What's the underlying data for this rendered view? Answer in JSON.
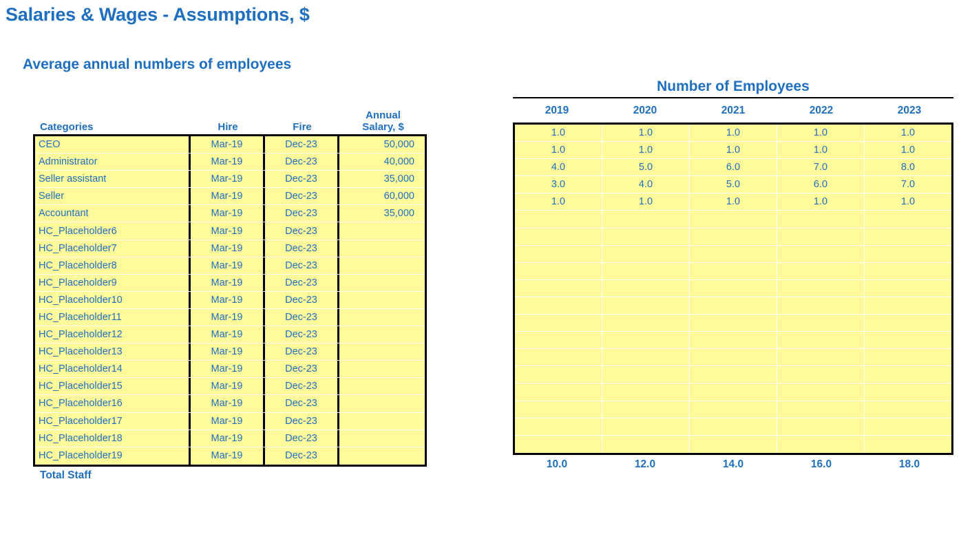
{
  "main_title": "Salaries & Wages - Assumptions, $",
  "section_title": "Average annual numbers of employees",
  "colors": {
    "accent_blue": "#1F6FC0",
    "cell_fill": "#FFFB9B",
    "border": "#000000"
  },
  "left_table": {
    "headers": {
      "categories": "Categories",
      "hire": "Hire",
      "fire": "Fire",
      "salary_line1": "Annual",
      "salary_line2": "Salary, $"
    },
    "rows": [
      {
        "category": "CEO",
        "hire": "Mar-19",
        "fire": "Dec-23",
        "salary": "50,000"
      },
      {
        "category": "Administrator",
        "hire": "Mar-19",
        "fire": "Dec-23",
        "salary": "40,000"
      },
      {
        "category": "Seller assistant",
        "hire": "Mar-19",
        "fire": "Dec-23",
        "salary": "35,000"
      },
      {
        "category": "Seller",
        "hire": "Mar-19",
        "fire": "Dec-23",
        "salary": "60,000"
      },
      {
        "category": "Accountant",
        "hire": "Mar-19",
        "fire": "Dec-23",
        "salary": "35,000"
      },
      {
        "category": "HC_Placeholder6",
        "hire": "Mar-19",
        "fire": "Dec-23",
        "salary": ""
      },
      {
        "category": "HC_Placeholder7",
        "hire": "Mar-19",
        "fire": "Dec-23",
        "salary": ""
      },
      {
        "category": "HC_Placeholder8",
        "hire": "Mar-19",
        "fire": "Dec-23",
        "salary": ""
      },
      {
        "category": "HC_Placeholder9",
        "hire": "Mar-19",
        "fire": "Dec-23",
        "salary": ""
      },
      {
        "category": "HC_Placeholder10",
        "hire": "Mar-19",
        "fire": "Dec-23",
        "salary": ""
      },
      {
        "category": "HC_Placeholder11",
        "hire": "Mar-19",
        "fire": "Dec-23",
        "salary": ""
      },
      {
        "category": "HC_Placeholder12",
        "hire": "Mar-19",
        "fire": "Dec-23",
        "salary": ""
      },
      {
        "category": "HC_Placeholder13",
        "hire": "Mar-19",
        "fire": "Dec-23",
        "salary": ""
      },
      {
        "category": "HC_Placeholder14",
        "hire": "Mar-19",
        "fire": "Dec-23",
        "salary": ""
      },
      {
        "category": "HC_Placeholder15",
        "hire": "Mar-19",
        "fire": "Dec-23",
        "salary": ""
      },
      {
        "category": "HC_Placeholder16",
        "hire": "Mar-19",
        "fire": "Dec-23",
        "salary": ""
      },
      {
        "category": "HC_Placeholder17",
        "hire": "Mar-19",
        "fire": "Dec-23",
        "salary": ""
      },
      {
        "category": "HC_Placeholder18",
        "hire": "Mar-19",
        "fire": "Dec-23",
        "salary": ""
      },
      {
        "category": "HC_Placeholder19",
        "hire": "Mar-19",
        "fire": "Dec-23",
        "salary": ""
      }
    ],
    "total_label": "Total Staff"
  },
  "right_table": {
    "title": "Number of Employees",
    "years": [
      "2019",
      "2020",
      "2021",
      "2022",
      "2023"
    ],
    "rows": [
      [
        "1.0",
        "1.0",
        "1.0",
        "1.0",
        "1.0"
      ],
      [
        "1.0",
        "1.0",
        "1.0",
        "1.0",
        "1.0"
      ],
      [
        "4.0",
        "5.0",
        "6.0",
        "7.0",
        "8.0"
      ],
      [
        "3.0",
        "4.0",
        "5.0",
        "6.0",
        "7.0"
      ],
      [
        "1.0",
        "1.0",
        "1.0",
        "1.0",
        "1.0"
      ],
      [
        "",
        "",
        "",
        "",
        ""
      ],
      [
        "",
        "",
        "",
        "",
        ""
      ],
      [
        "",
        "",
        "",
        "",
        ""
      ],
      [
        "",
        "",
        "",
        "",
        ""
      ],
      [
        "",
        "",
        "",
        "",
        ""
      ],
      [
        "",
        "",
        "",
        "",
        ""
      ],
      [
        "",
        "",
        "",
        "",
        ""
      ],
      [
        "",
        "",
        "",
        "",
        ""
      ],
      [
        "",
        "",
        "",
        "",
        ""
      ],
      [
        "",
        "",
        "",
        "",
        ""
      ],
      [
        "",
        "",
        "",
        "",
        ""
      ],
      [
        "",
        "",
        "",
        "",
        ""
      ],
      [
        "",
        "",
        "",
        "",
        ""
      ],
      [
        "",
        "",
        "",
        "",
        ""
      ]
    ],
    "totals": [
      "10.0",
      "12.0",
      "14.0",
      "16.0",
      "18.0"
    ]
  },
  "chart_data": {
    "type": "table",
    "title": "Number of Employees",
    "categories": [
      "CEO",
      "Administrator",
      "Seller assistant",
      "Seller",
      "Accountant"
    ],
    "x": [
      "2019",
      "2020",
      "2021",
      "2022",
      "2023"
    ],
    "series": [
      {
        "name": "CEO",
        "values": [
          1,
          1,
          1,
          1,
          1
        ]
      },
      {
        "name": "Administrator",
        "values": [
          1,
          1,
          1,
          1,
          1
        ]
      },
      {
        "name": "Seller assistant",
        "values": [
          4,
          5,
          6,
          7,
          8
        ]
      },
      {
        "name": "Seller",
        "values": [
          3,
          4,
          5,
          6,
          7
        ]
      },
      {
        "name": "Accountant",
        "values": [
          1,
          1,
          1,
          1,
          1
        ]
      }
    ],
    "totals": [
      10,
      12,
      14,
      16,
      18
    ],
    "salaries": {
      "CEO": 50000,
      "Administrator": 40000,
      "Seller assistant": 35000,
      "Seller": 60000,
      "Accountant": 35000
    },
    "xlabel": "",
    "ylabel": ""
  }
}
